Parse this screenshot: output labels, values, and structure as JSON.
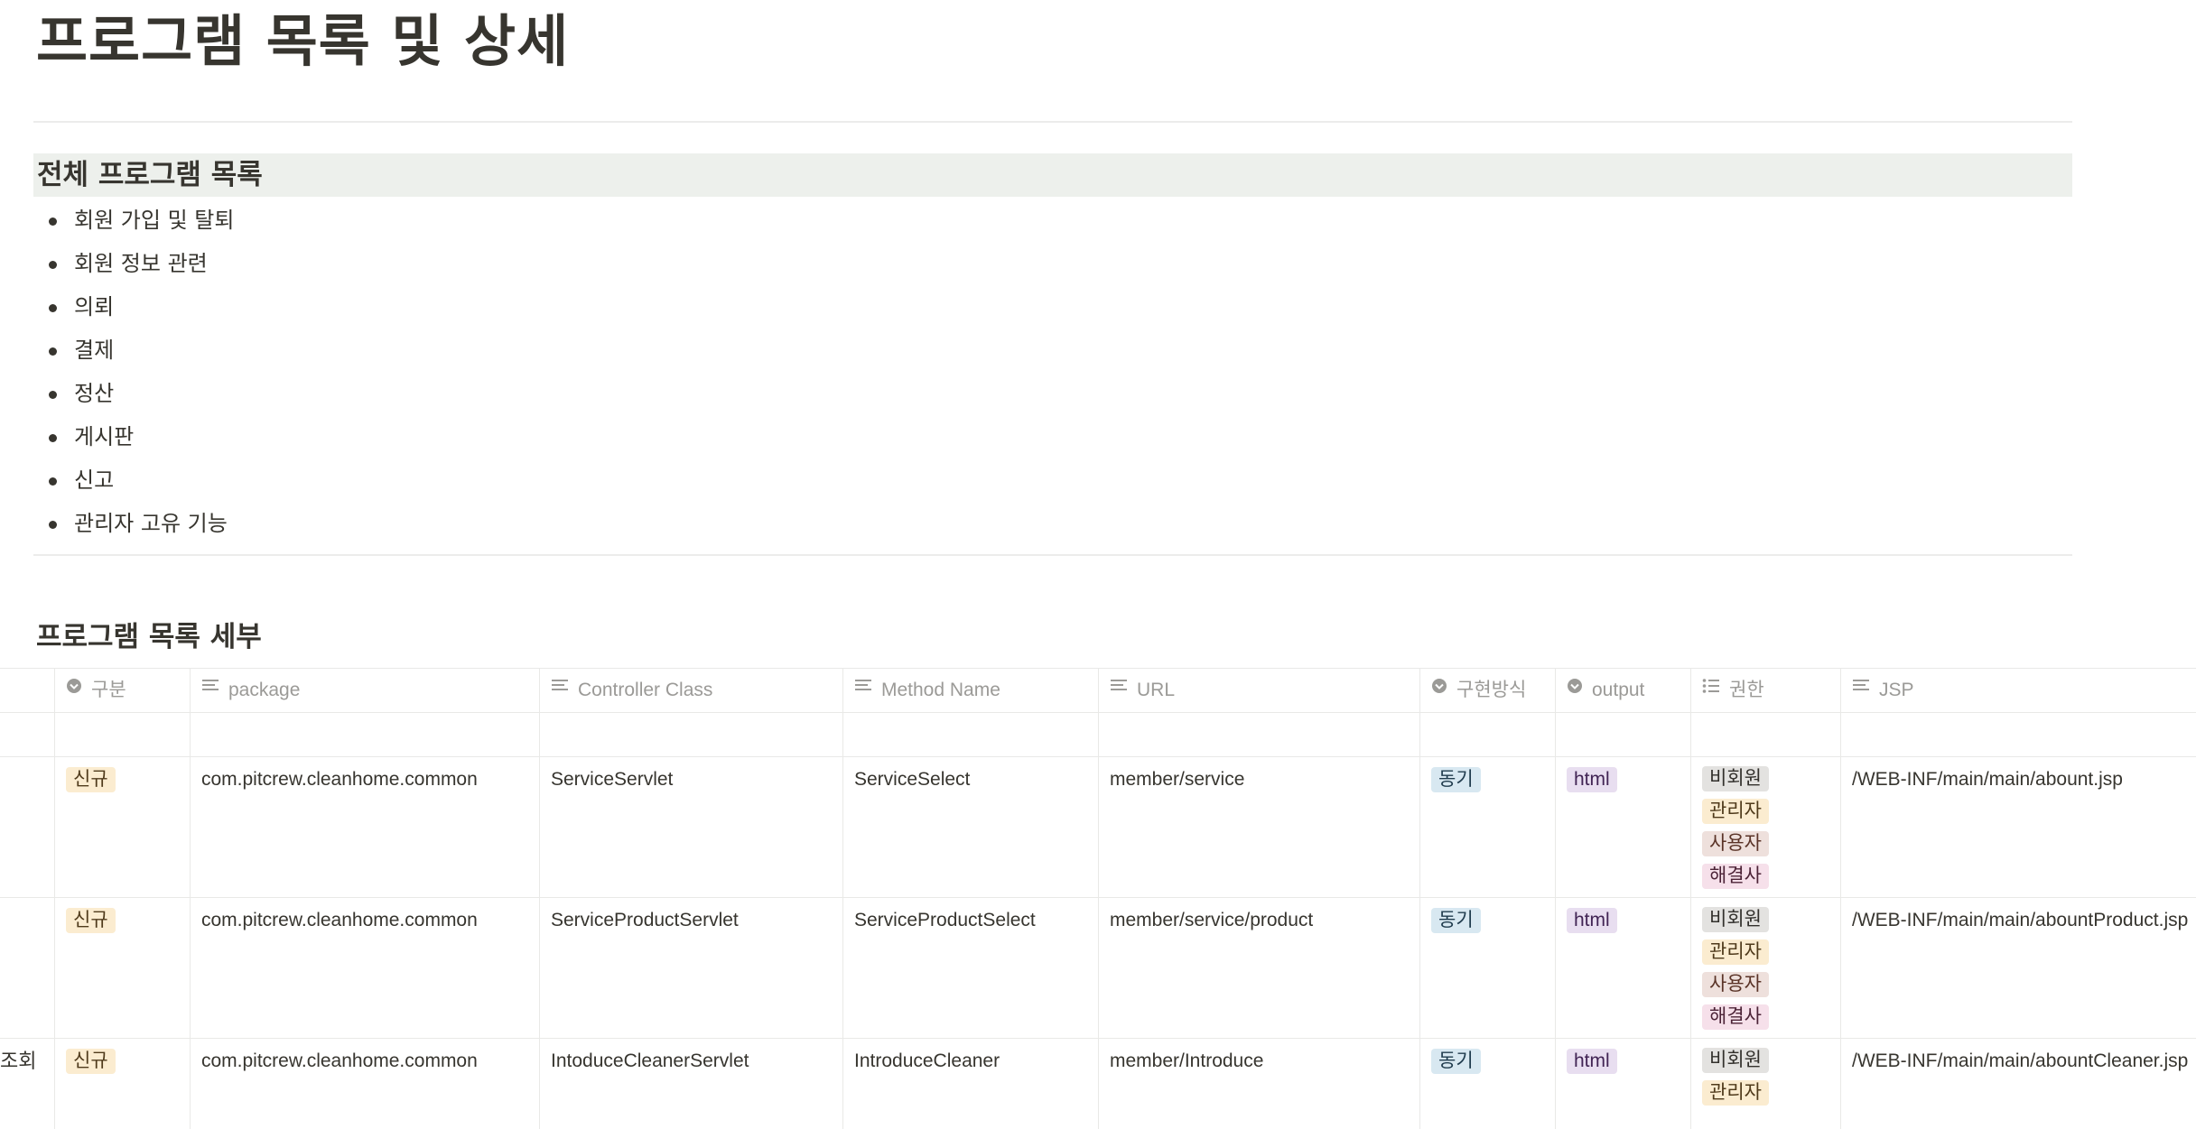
{
  "page": {
    "title": "프로그램 목록 및 상세"
  },
  "overview": {
    "heading": "전체 프로그램 목록",
    "items": [
      "회원 가입 및 탈퇴",
      "회원 정보 관련",
      "의뢰",
      "결제",
      "정산",
      "게시판",
      "신고",
      "관리자 고유 기능"
    ]
  },
  "detail": {
    "heading": "프로그램 목록 세부",
    "columns": [
      {
        "label": "구분",
        "icon": "select-icon"
      },
      {
        "label": "package",
        "icon": "text-property-icon"
      },
      {
        "label": "Controller Class",
        "icon": "text-property-icon"
      },
      {
        "label": "Method Name",
        "icon": "text-property-icon"
      },
      {
        "label": "URL",
        "icon": "text-property-icon"
      },
      {
        "label": "구현방식",
        "icon": "select-icon"
      },
      {
        "label": "output",
        "icon": "select-icon"
      },
      {
        "label": "권한",
        "icon": "multi-select-icon"
      },
      {
        "label": "JSP",
        "icon": "text-property-icon"
      }
    ],
    "rows": [
      {
        "stub": "",
        "category": "신규",
        "package": "com.pitcrew.cleanhome.common",
        "controller": "ServiceServlet",
        "method": "ServiceSelect",
        "url": "member/service",
        "impl": "동기",
        "output": "html",
        "roles": [
          "비회원",
          "관리자",
          "사용자",
          "해결사"
        ],
        "jsp": "/WEB-INF/main/main/abount.jsp"
      },
      {
        "stub": "",
        "category": "신규",
        "package": "com.pitcrew.cleanhome.common",
        "controller": "ServiceProductServlet",
        "method": "ServiceProductSelect",
        "url": "member/service/product",
        "impl": "동기",
        "output": "html",
        "roles": [
          "비회원",
          "관리자",
          "사용자",
          "해결사"
        ],
        "jsp": "/WEB-INF/main/main/abountProduct.jsp"
      },
      {
        "stub": "조회",
        "category": "신규",
        "package": "com.pitcrew.cleanhome.common",
        "controller": "IntoduceCleanerServlet",
        "method": "IntroduceCleaner",
        "url": "member/Introduce",
        "impl": "동기",
        "output": "html",
        "roles": [
          "비회원",
          "관리자"
        ],
        "jsp": "/WEB-INF/main/main/abountCleaner.jsp"
      }
    ]
  },
  "tag_colors": {
    "신규": {
      "bg": "#fbecd0",
      "fg": "#4f3a1b"
    },
    "동기": {
      "bg": "#d8e8f1",
      "fg": "#1f3b4d"
    },
    "html": {
      "bg": "#e8def0",
      "fg": "#412454"
    },
    "비회원": {
      "bg": "#e3e2e0",
      "fg": "#32302c"
    },
    "관리자": {
      "bg": "#fbecd0",
      "fg": "#4f3a1b"
    },
    "사용자": {
      "bg": "#eee0dc",
      "fg": "#5a3327"
    },
    "해결사": {
      "bg": "#f6e0ea",
      "fg": "#4c2337"
    }
  }
}
